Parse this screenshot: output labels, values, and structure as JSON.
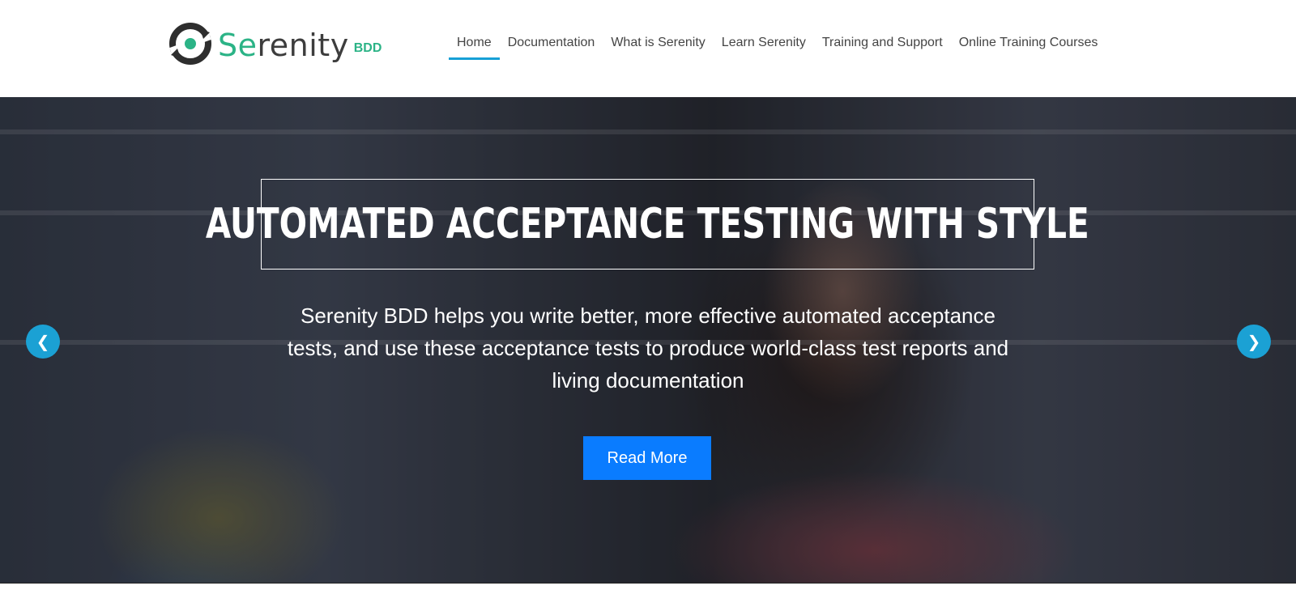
{
  "logo": {
    "word_accent": "Se",
    "word_rest": "renity",
    "suffix": "BDD",
    "colors": {
      "brand_green": "#2bb386",
      "dark": "#3d3d3d"
    }
  },
  "nav": {
    "items": [
      {
        "label": "Home",
        "active": true
      },
      {
        "label": "Documentation",
        "active": false
      },
      {
        "label": "What is Serenity",
        "active": false
      },
      {
        "label": "Learn Serenity",
        "active": false
      },
      {
        "label": "Training and Support",
        "active": false
      },
      {
        "label": "Online Training Courses",
        "active": false
      }
    ],
    "active_underline_color": "#17a0d6"
  },
  "hero": {
    "title": "Automated Acceptance Testing With Style",
    "subtitle": "Serenity BDD helps you write better, more effective automated acceptance tests, and use these acceptance tests to produce world-class test reports and living documentation",
    "cta_label": "Read More",
    "cta_color": "#0a7cff",
    "prev_icon": "chevron-left-icon",
    "next_icon": "chevron-right-icon",
    "arrow_color": "#1ba1d4"
  }
}
